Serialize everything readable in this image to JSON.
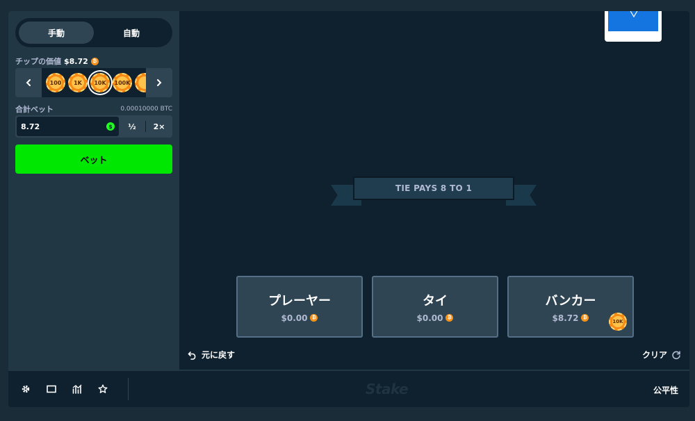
{
  "sidebar": {
    "mode_tabs": [
      {
        "label": "手動",
        "active": true
      },
      {
        "label": "自動",
        "active": false
      }
    ],
    "chip_value": {
      "label": "チップの価値",
      "value": "$8.72"
    },
    "chips": [
      "100",
      "1K",
      "10K",
      "100K"
    ],
    "selected_chip": "10K",
    "total_bet": {
      "label": "合計ベット",
      "btc_value": "0.00010000 BTC",
      "input_value": "8.72",
      "half_label": "½",
      "double_label": "2×"
    },
    "bet_button_label": "ベット"
  },
  "game": {
    "banner_text": "TIE PAYS 8 TO 1",
    "bet_spots": [
      {
        "name": "プレーヤー",
        "amount": "$0.00"
      },
      {
        "name": "タイ",
        "amount": "$0.00"
      },
      {
        "name": "バンカー",
        "amount": "$8.72",
        "chip": "10K"
      }
    ],
    "undo_label": "元に戻す",
    "clear_label": "クリア"
  },
  "footer": {
    "icons": [
      "gear-icon",
      "theatre-mode-icon",
      "stats-icon",
      "favourite-star-icon"
    ],
    "logo_text": "Stake",
    "fairness_label": "公平性"
  },
  "colors": {
    "background": "#1a2c38",
    "panel": "#213743",
    "game_bg": "#0f212e",
    "accent_green": "#00e701",
    "btc_orange": "#f7931a",
    "card_blue": "#1475e1"
  }
}
